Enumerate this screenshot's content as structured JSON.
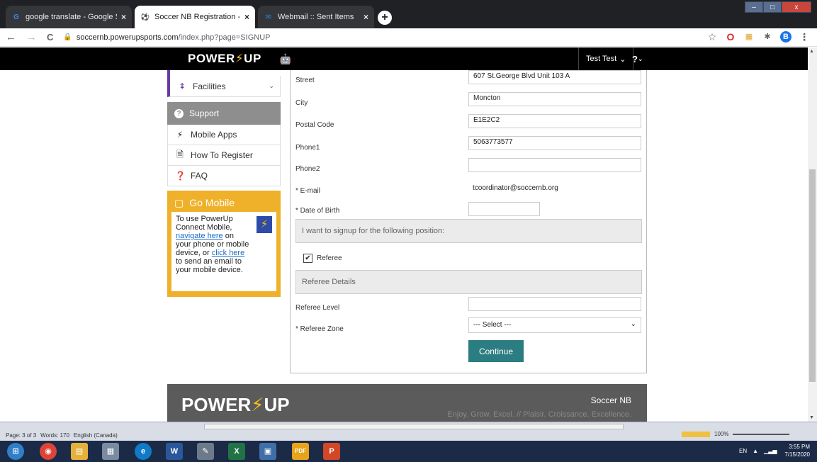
{
  "browser": {
    "tabs": [
      {
        "label": "google translate - Google Search",
        "favicon": "G",
        "close": "×"
      },
      {
        "label": "Soccer NB Registration - Referee",
        "favicon": "⚽",
        "close": "×"
      },
      {
        "label": "Webmail :: Sent Items",
        "favicon": "✉",
        "close": "×"
      }
    ],
    "new_tab": "+",
    "window_buttons": {
      "minimize": "–",
      "maximize": "□",
      "close": "x"
    },
    "url_host": "soccernb.powerupsports.com",
    "url_path": "/index.php?page=SIGNUP",
    "extensions": [
      "☆",
      "O",
      "▦",
      "✱",
      "B",
      "⋮"
    ],
    "nav": {
      "back": "←",
      "forward": "→",
      "reload": "C",
      "lock": "🔒"
    }
  },
  "header": {
    "logo_left": "POWER",
    "logo_bolt": "⚡",
    "logo_right": "UP",
    "apple_icon": "",
    "android_icon": "🤖",
    "user_name": "Test Test",
    "user_caret": "⌄",
    "help": "?",
    "help_caret": "⌄"
  },
  "sidebar": {
    "facilities": {
      "label": "Facilities",
      "icon": "⇞",
      "caret": "⌄"
    },
    "support": {
      "label": "Support",
      "icon": "?"
    },
    "items": [
      {
        "label": "Mobile Apps",
        "icon": "⚡"
      },
      {
        "label": "How To Register",
        "icon": "🗎"
      },
      {
        "label": "FAQ",
        "icon": "❓"
      }
    ],
    "go_mobile": {
      "title": "Go Mobile",
      "icon": "▢",
      "text_1": "To use PowerUp Connect Mobile,",
      "link_1": "navigate here",
      "text_2": " on your phone or mobile device, or ",
      "link_2": "click here",
      "text_3": " to send an email to your mobile device.",
      "badge": "⚡"
    }
  },
  "form": {
    "street": {
      "label": "Street",
      "value": "607 St.George Blvd Unit 103 A"
    },
    "city": {
      "label": "City",
      "value": "Moncton"
    },
    "postal": {
      "label": "Postal Code",
      "value": "E1E2C2"
    },
    "phone1": {
      "label": "Phone1",
      "value": "5063773577"
    },
    "phone2": {
      "label": "Phone2",
      "value": ""
    },
    "email": {
      "label": "* E-mail",
      "value": "tcoordinator@soccernb.org"
    },
    "dob": {
      "label": "* Date of Birth",
      "value": ""
    },
    "position_header": "I want to signup for the following position:",
    "referee_checkbox": {
      "label": "Referee",
      "checked": "✔"
    },
    "referee_header": "Referee Details",
    "referee_level": {
      "label": "Referee Level",
      "value": ""
    },
    "referee_zone": {
      "label": "* Referee Zone",
      "value": "--- Select ---",
      "caret": "⌄"
    },
    "continue": "Continue"
  },
  "footer": {
    "logo_left": "POWER",
    "logo_bolt": "⚡",
    "logo_right": "UP",
    "org": "Soccer NB",
    "tagline": "Enjoy. Grow. Excel. // Plaisir. Croissance. Excellence."
  },
  "word_status": {
    "page": "Page: 3 of 3",
    "words": "Words: 170",
    "language": "English (Canada)",
    "zoom": "100%"
  },
  "taskbar": {
    "time": "3:55 PM",
    "date": "7/15/2020",
    "lang": "EN",
    "icons": [
      {
        "name": "start",
        "glyph": "⊞",
        "color": "#2f7fc8"
      },
      {
        "name": "chrome",
        "glyph": "◉",
        "color": "#db4437"
      },
      {
        "name": "explorer",
        "glyph": "▤",
        "color": "#e5b13a"
      },
      {
        "name": "calculator",
        "glyph": "▦",
        "color": "#7a8aa0"
      },
      {
        "name": "edge",
        "glyph": "e",
        "color": "#0f7ac6"
      },
      {
        "name": "word",
        "glyph": "W",
        "color": "#2b579a"
      },
      {
        "name": "paint",
        "glyph": "✎",
        "color": "#6c7a8a"
      },
      {
        "name": "excel",
        "glyph": "X",
        "color": "#217346"
      },
      {
        "name": "photos",
        "glyph": "▣",
        "color": "#3f6fa8"
      },
      {
        "name": "pdf",
        "glyph": "PDF",
        "color": "#e8a31a"
      },
      {
        "name": "powerpoint",
        "glyph": "P",
        "color": "#d24726"
      }
    ]
  }
}
